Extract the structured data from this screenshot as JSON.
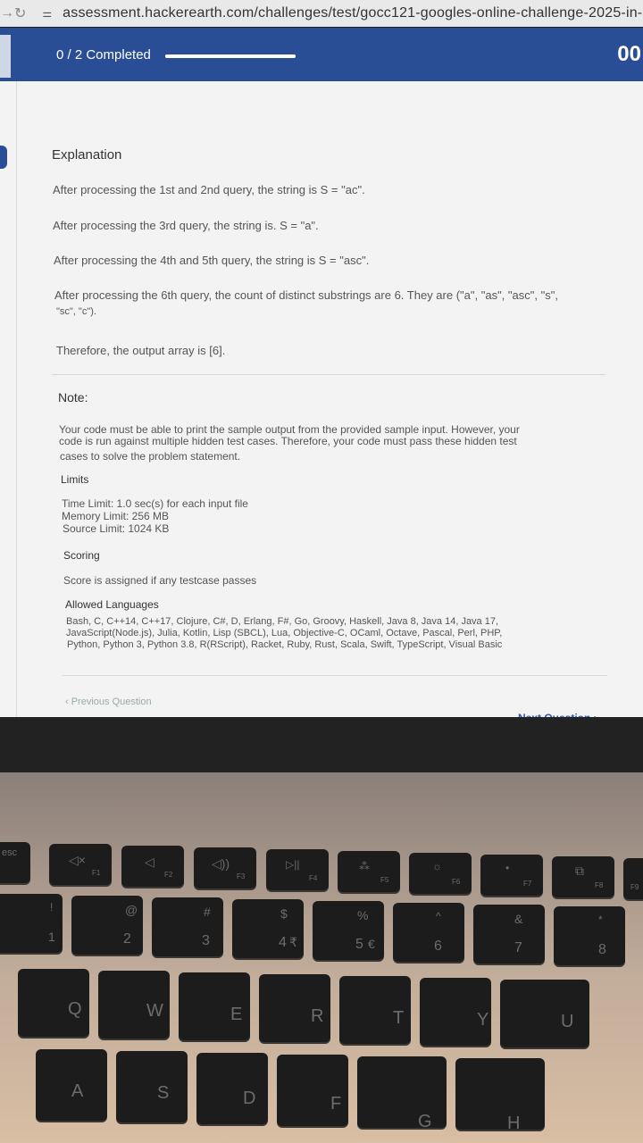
{
  "browser": {
    "url": "assessment.hackerearth.com/challenges/test/gocc121-googles-online-challenge-2025-in-stu"
  },
  "progress": {
    "status": "0 / 2 Completed",
    "fraction": 0.0,
    "timer": "00"
  },
  "explanation": {
    "heading": "Explanation",
    "lines": [
      "After processing the 1st and 2nd query, the string is S = \"ac\".",
      "After processing the 3rd query, the string is. S = \"a\".",
      "After processing the 4th and 5th query, the string is S = \"asc\".",
      "After processing the 6th query, the count of distinct substrings are 6. They are (\"a\", \"as\", \"asc\", \"s\",",
      "\"sc\", \"c\").",
      "Therefore, the output array is [6]."
    ]
  },
  "note": {
    "heading": "Note:",
    "lines": [
      "Your code must be able to print the sample output from the provided sample input. However, your",
      "code is run against multiple hidden test cases. Therefore, your code must pass these hidden test",
      "cases to solve the problem statement."
    ]
  },
  "limits": {
    "heading": "Limits",
    "lines": [
      "Time Limit: 1.0 sec(s) for each input file",
      "Memory Limit: 256 MB",
      "Source Limit: 1024 KB"
    ]
  },
  "scoring": {
    "heading": "Scoring",
    "text": "Score is assigned if any testcase passes"
  },
  "languages": {
    "heading": "Allowed Languages",
    "lines": [
      "Bash, C, C++14, C++17, Clojure, C#, D, Erlang, F#, Go, Groovy, Haskell, Java 8, Java 14, Java 17,",
      "JavaScript(Node.js), Julia, Kotlin, Lisp (SBCL), Lua, Objective-C, OCaml, Octave, Pascal, Perl, PHP,",
      "Python, Python 3, Python 3.8, R(RScript), Racket, Ruby, Rust, Scala, Swift, TypeScript, Visual Basic"
    ]
  },
  "navigation": {
    "previous": "‹ Previous Question",
    "next": "Next Question ›"
  },
  "keyboard": {
    "esc": "esc",
    "fn_row": [
      "F1",
      "F2",
      "F3",
      "F4",
      "F5",
      "F6",
      "F7",
      "F8",
      "F9"
    ],
    "number_row": [
      "1",
      "2",
      "3",
      "4",
      "5",
      "6",
      "7",
      "8"
    ],
    "number_row_shift": [
      "!",
      "@",
      "#",
      "$",
      "%",
      "^",
      "&",
      "*"
    ],
    "rupee": "₹",
    "euro": "€",
    "letter_row1": [
      "Q",
      "W",
      "E",
      "R",
      "T",
      "Y",
      "U"
    ],
    "letter_row2": [
      "A",
      "S",
      "D",
      "F",
      "G",
      "H"
    ]
  }
}
